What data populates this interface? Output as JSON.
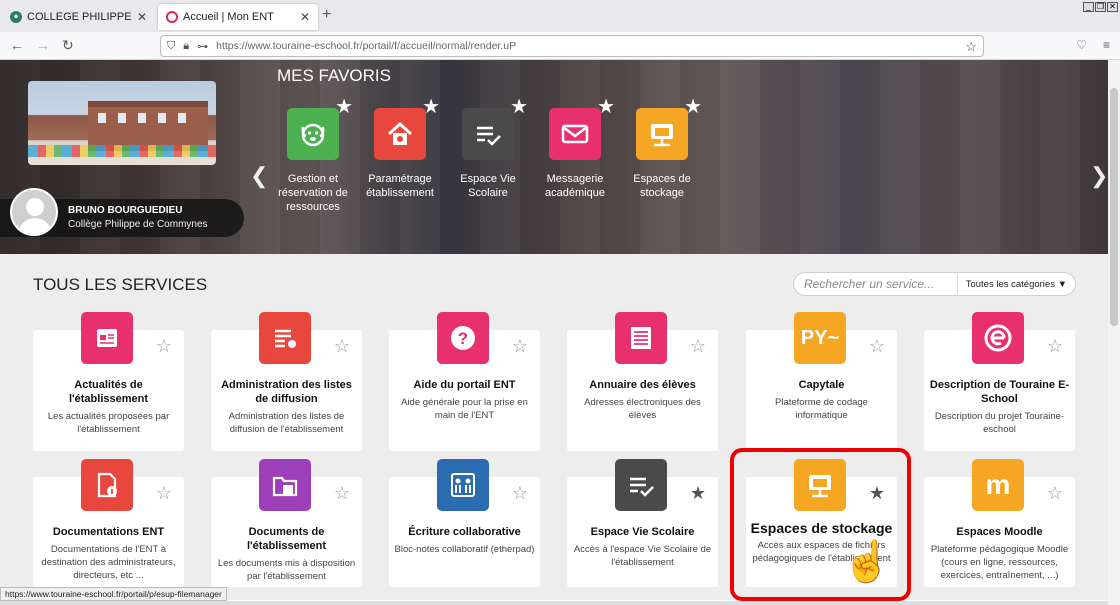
{
  "browser": {
    "tabs": [
      {
        "label": "COLLEGE PHILIPPE DE COMMY",
        "favicon_color": "#2e7d6b"
      },
      {
        "label": "Accueil | Mon ENT",
        "favicon_color": "#e0245e"
      }
    ],
    "url": "https://www.touraine-eschool.fr/portail/f/accueil/normal/render.uP",
    "status_url": "https://www.touraine-eschool.fr/portail/p/esup-filemanager"
  },
  "hero": {
    "favorites_title": "MES FAVORIS",
    "user_name": "BRUNO BOURGUEDIEU",
    "school": "Collège Philippe de Commynes",
    "favorites": [
      {
        "label": "Gestion et réservation de ressources",
        "color": "#4caf50",
        "icon": "dog-icon"
      },
      {
        "label": "Paramétrage établissement",
        "color": "#e8473d",
        "icon": "house-gear-icon"
      },
      {
        "label": "Espace Vie Scolaire",
        "color": "#4a4a4a",
        "icon": "list-check-icon"
      },
      {
        "label": "Messagerie académique",
        "color": "#e8306e",
        "icon": "mail-icon"
      },
      {
        "label": "Espaces de stockage",
        "color": "#f5a623",
        "icon": "folder-network-icon"
      }
    ]
  },
  "services": {
    "title": "TOUS LES SERVICES",
    "search_placeholder": "Rechercher un service...",
    "category_select": "Toutes les catégories",
    "cards": [
      {
        "name": "Actualités de l'établissement",
        "desc": "Les actualités proposées par l'établissement",
        "color": "#e8306e",
        "icon": "news-icon"
      },
      {
        "name": "Administration des listes de diffusion",
        "desc": "Administration des listes de diffusion de l'établissement",
        "color": "#e8473d",
        "icon": "list-gear-icon"
      },
      {
        "name": "Aide du portail ENT",
        "desc": "Aide générale pour la prise en main de l'ENT",
        "color": "#e8306e",
        "icon": "question-icon"
      },
      {
        "name": "Annuaire des élèves",
        "desc": "Adresses électroniques des élèves",
        "color": "#e8306e",
        "icon": "directory-icon"
      },
      {
        "name": "Capytale",
        "desc": "Plateforme de codage informatique",
        "color": "#f5a623",
        "icon": "python-icon"
      },
      {
        "name": "Description de Touraine E-School",
        "desc": "Description du projet Touraine-eschool",
        "color": "#e8306e",
        "icon": "eschool-logo-icon"
      },
      {
        "name": "Documentations ENT",
        "desc": "Documentations de l'ENT à destination des administrateurs, directeurs, etc ...",
        "color": "#e8473d",
        "icon": "document-info-icon"
      },
      {
        "name": "Documents de l'établissement",
        "desc": "Les documents mis à disposition par l'établissement",
        "color": "#9c3fb8",
        "icon": "folder-doc-icon"
      },
      {
        "name": "Écriture collaborative",
        "desc": "Bloc-notes collaboratif (etherpad)",
        "color": "#2b6cb0",
        "icon": "collab-icon"
      },
      {
        "name": "Espace Vie Scolaire",
        "desc": "Accès à l'espace Vie Scolaire de l'établissement",
        "color": "#4a4a4a",
        "icon": "list-check-icon"
      },
      {
        "name": "Espaces de stockage",
        "desc": "Accès aux espaces de fichiers pédagogiques de l'établissement",
        "color": "#f5a623",
        "icon": "folder-network-icon"
      },
      {
        "name": "Espaces Moodle",
        "desc": "Plateforme pédagogique Moodle (cours en ligne, ressources, exercices, entraînement, ...)",
        "color": "#f5a623",
        "icon": "moodle-icon"
      }
    ]
  }
}
